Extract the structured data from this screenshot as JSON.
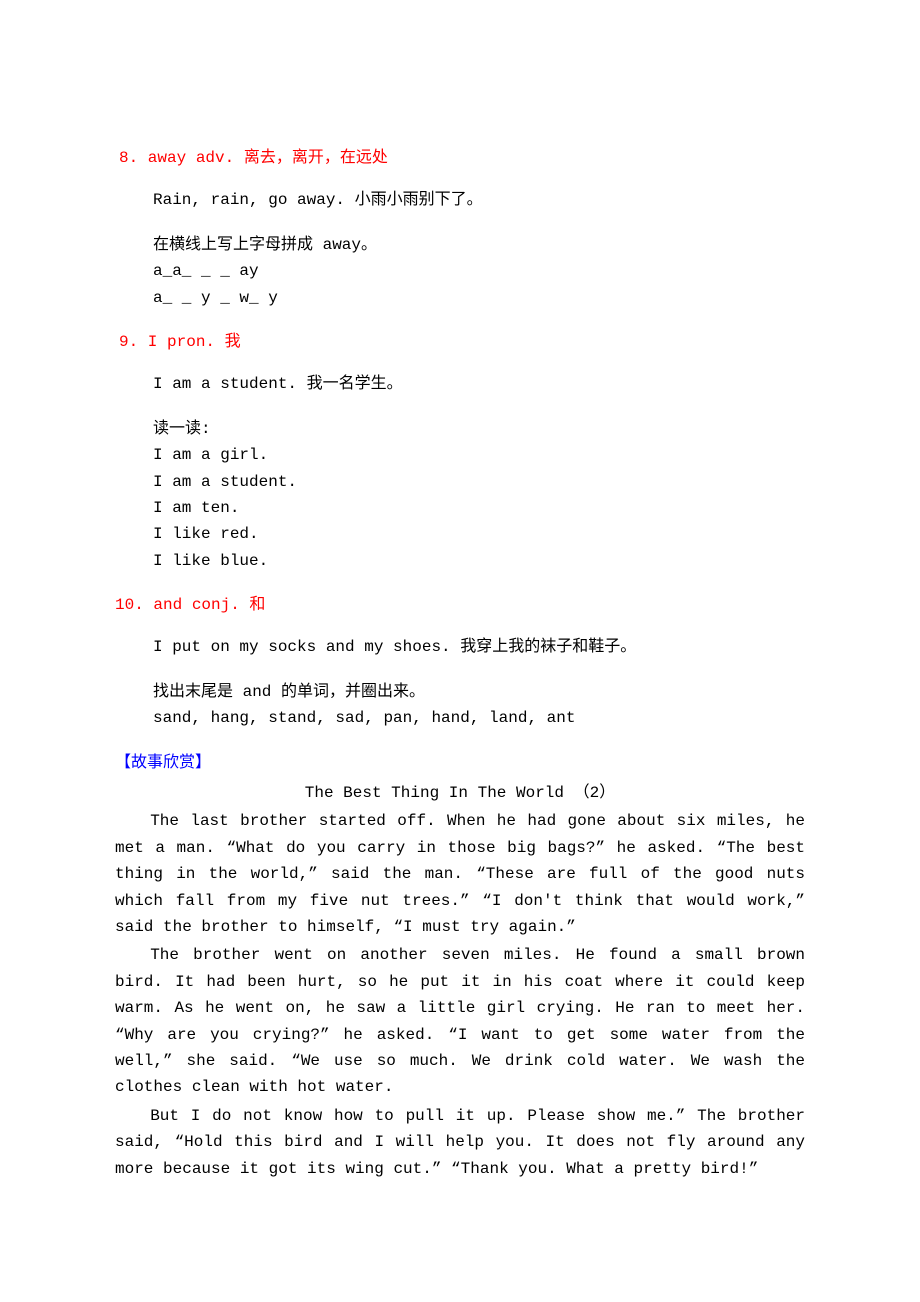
{
  "q8": {
    "heading": "8. away  adv. 离去，离开，在远处",
    "example": "Rain, rain, go away. 小雨小雨别下了。",
    "instr": "在横线上写上字母拼成 away。",
    "line1": "a_a_    _ _ ay",
    "line2": "a_ _ y   _ w_ y"
  },
  "q9": {
    "heading": "9. I  pron. 我",
    "example": "I am a student. 我一名学生。",
    "instr": "读一读:",
    "r1": "I am a girl.",
    "r2": "I am a student.",
    "r3": "I am ten.",
    "r4": "I like red.",
    "r5": "I like blue."
  },
  "q10": {
    "heading": "10. and  conj. 和",
    "example": "I put on my socks and my shoes. 我穿上我的袜子和鞋子。",
    "instr": "找出末尾是 and 的单词，并圈出来。",
    "words": "sand,  hang,  stand,  sad,  pan,  hand,  land,  ant"
  },
  "story": {
    "sectionTitle": "【故事欣赏】",
    "title": "The Best Thing In The World （2）",
    "p1": "The last brother started off. When he had gone about six miles, he met a man. “What do you carry in those big bags?” he asked. “The best thing in the world,” said the man. “These are full of the good nuts which fall from my five nut trees.” “I don't think that would work,” said the brother to himself, “I must try again.”",
    "p2": "The brother went on another seven miles. He found a small brown bird. It had been hurt, so he put it in his coat where it could keep warm. As he went on, he saw a little girl crying. He ran to meet her. “Why are you crying?” he asked. “I want to get some water from the well,” she said. “We use so much. We drink cold water. We wash the clothes clean with hot water.",
    "p3": "But I do not know how to pull it up. Please show me.” The brother said, “Hold this bird and I will help you. It does not fly around any more because it got its wing cut.” “Thank you. What a pretty bird!”"
  }
}
